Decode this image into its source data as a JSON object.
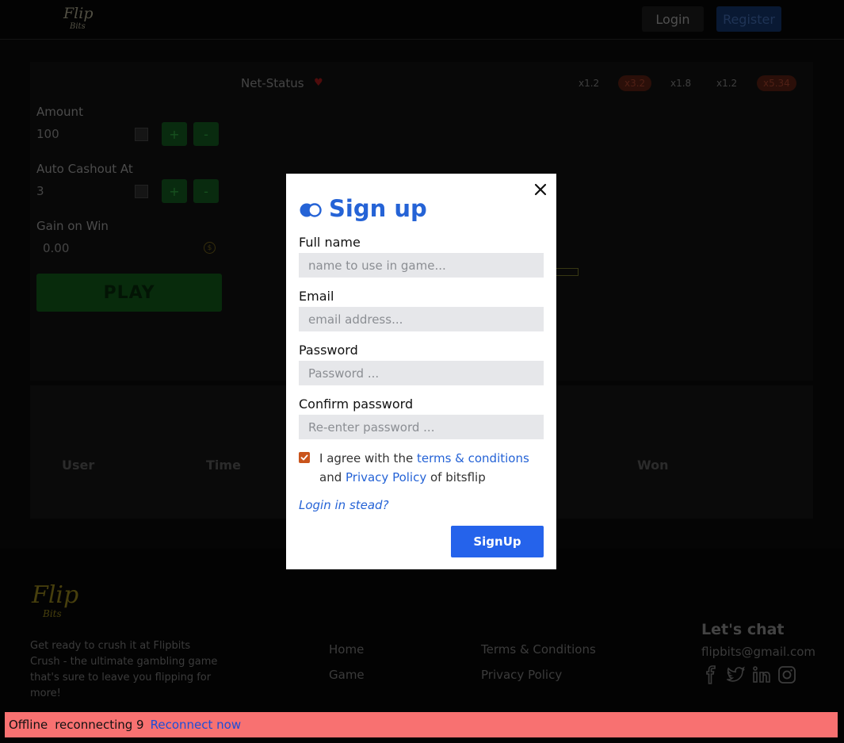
{
  "header": {
    "logo_main": "Flip",
    "logo_sub": "Bits",
    "login_label": "Login",
    "register_label": "Register"
  },
  "game": {
    "net_status_label": "Net-Status",
    "multipliers": [
      {
        "label": "x1.2",
        "style": "plain"
      },
      {
        "label": "x3.2",
        "style": "red"
      },
      {
        "label": "x1.8",
        "style": "plain"
      },
      {
        "label": "x1.2",
        "style": "plain"
      },
      {
        "label": "x5.34",
        "style": "red"
      }
    ],
    "amount_label": "Amount",
    "amount_value": "100",
    "auto_cashout_label": "Auto Cashout At",
    "auto_cashout_value": "3",
    "plus_label": "+",
    "minus_label": "-",
    "gain_label": "Gain on Win",
    "gain_value": "0.00",
    "play_label": "PLAY"
  },
  "table": {
    "col_user": "User",
    "col_time": "Time",
    "col_won": "Won"
  },
  "footer": {
    "logo_main": "Flip",
    "logo_sub": "Bits",
    "description": "Get ready to crush it at Flipbits Crush - the ultimate gambling game that's sure to leave you flipping for more!",
    "link_home": "Home",
    "link_game": "Game",
    "link_terms": "Terms & Conditions",
    "link_privacy": "Privacy Policy",
    "lets_chat": "Let's chat",
    "email": "flipbits@gmail.com"
  },
  "modal": {
    "title": "Sign up",
    "fullname_label": "Full name",
    "fullname_placeholder": "name to use in game...",
    "email_label": "Email",
    "email_placeholder": "email address...",
    "password_label": "Password",
    "password_placeholder": "Password ...",
    "confirm_label": "Confirm password",
    "confirm_placeholder": "Re-enter password ...",
    "agree_prefix": "I agree with the ",
    "agree_terms": "terms & conditions",
    "agree_and": " and ",
    "agree_privacy": "Privacy Policy",
    "agree_suffix": " of bitsflip",
    "agree_checked": true,
    "login_instead": "Login in stead?",
    "signup_label": "SignUp"
  },
  "status_bar": {
    "offline": "Offline",
    "reconnecting": "reconnecting 9",
    "reconnect_now": "Reconnect now"
  },
  "colors": {
    "accent_blue": "#2563eb",
    "checkbox_orange": "#c9541c",
    "offline_bar": "#f87171"
  }
}
